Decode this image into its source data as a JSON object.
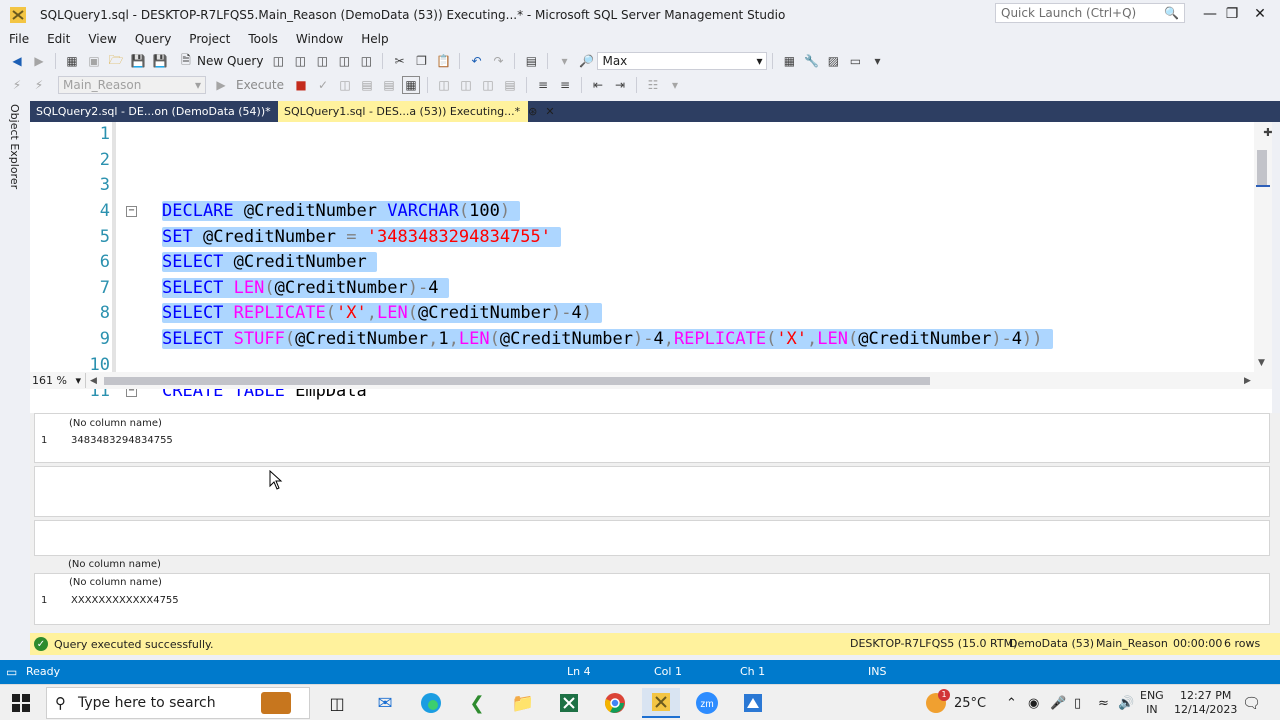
{
  "window": {
    "title": "SQLQuery1.sql - DESKTOP-R7LFQS5.Main_Reason (DemoData (53)) Executing...* - Microsoft SQL Server Management Studio",
    "quick_launch_placeholder": "Quick Launch (Ctrl+Q)"
  },
  "menu": [
    "File",
    "Edit",
    "View",
    "Query",
    "Project",
    "Tools",
    "Window",
    "Help"
  ],
  "toolbar": {
    "new_query_label": "New Query",
    "solution_config": "Max",
    "database_select": "Main_Reason",
    "execute_label": "Execute"
  },
  "object_explorer_label": "Object Explorer",
  "tabs": [
    {
      "label": "SQLQuery2.sql - DE...on (DemoData (54))*"
    },
    {
      "label": "SQLQuery1.sql - DES...a (53)) Executing...*"
    }
  ],
  "editor": {
    "line_numbers": [
      "1",
      "2",
      "3",
      "4",
      "5",
      "6",
      "7",
      "8",
      "9",
      "10",
      "11"
    ],
    "zoom": "161 %"
  },
  "results": {
    "grid1": {
      "header": "(No column name)",
      "row_num": "1",
      "value": "3483483294834755"
    },
    "grid4": {
      "header": "(No column name)"
    },
    "grid5": {
      "header": "(No column name)",
      "row_num": "1",
      "value": "XXXXXXXXXXXX4755"
    }
  },
  "query_status": {
    "message": "Query executed successfully.",
    "server": "DESKTOP-R7LFQS5 (15.0 RTM)",
    "connection": "DemoData (53)",
    "database": "Main_Reason",
    "elapsed": "00:00:00",
    "rows": "6 rows"
  },
  "statusbar": {
    "ready": "Ready",
    "ln": "Ln 4",
    "col": "Col 1",
    "ch": "Ch 1",
    "mode": "INS"
  },
  "taskbar": {
    "search_placeholder": "Type here to search",
    "weather": "25°C",
    "lang1": "ENG",
    "lang2": "IN",
    "time": "12:27 PM",
    "date": "12/14/2023",
    "weather_badge": "1"
  },
  "colors": {
    "accent": "#007acc",
    "tab_active": "#fff29d",
    "tab_bar": "#2d3e62",
    "selection": "#add6ff"
  }
}
